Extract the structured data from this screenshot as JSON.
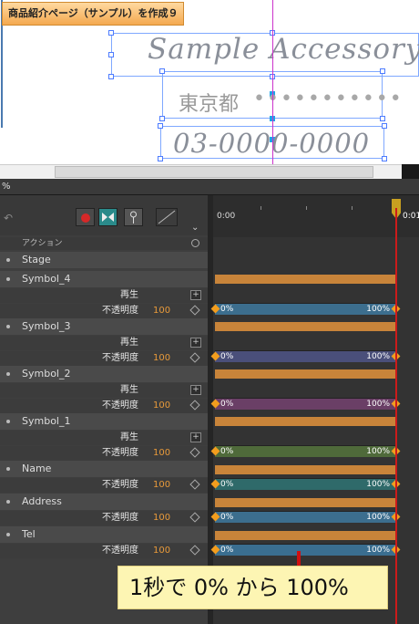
{
  "stage": {
    "title": "商品紹介ページ（サンプル）を作成９",
    "sample": "Sample Accessory",
    "address": "東京都",
    "dots": "•••••••••••",
    "tel": "03-0000-0000"
  },
  "pct": "%",
  "timeline": {
    "ruler_start": "0:00",
    "ruler_end": "0:01",
    "actions_label": "アクション",
    "stage_label": "Stage",
    "symbols": [
      {
        "name": "Symbol_4",
        "play": "再生",
        "opacity_label": "不透明度",
        "opacity": "100",
        "from": "0%",
        "to": "100%",
        "color": "#3c6e8e"
      },
      {
        "name": "Symbol_3",
        "play": "再生",
        "opacity_label": "不透明度",
        "opacity": "100",
        "from": "0%",
        "to": "100%",
        "color": "#4a4f7a"
      },
      {
        "name": "Symbol_2",
        "play": "再生",
        "opacity_label": "不透明度",
        "opacity": "100",
        "from": "0%",
        "to": "100%",
        "color": "#6a3f66"
      },
      {
        "name": "Symbol_1",
        "play": "再生",
        "opacity_label": "不透明度",
        "opacity": "100",
        "from": "0%",
        "to": "100%",
        "color": "#4f6a3a"
      },
      {
        "name": "Name",
        "opacity_label": "不透明度",
        "opacity": "100",
        "from": "0%",
        "to": "100%",
        "color": "#2f6a6a"
      },
      {
        "name": "Address",
        "opacity_label": "不透明度",
        "opacity": "100",
        "from": "0%",
        "to": "100%",
        "color": "#3c6e8e"
      },
      {
        "name": "Tel",
        "opacity_label": "不透明度",
        "opacity": "100",
        "from": "0%",
        "to": "100%",
        "color": "#3a6e90"
      }
    ]
  },
  "note": "1秒で 0% から 100%"
}
